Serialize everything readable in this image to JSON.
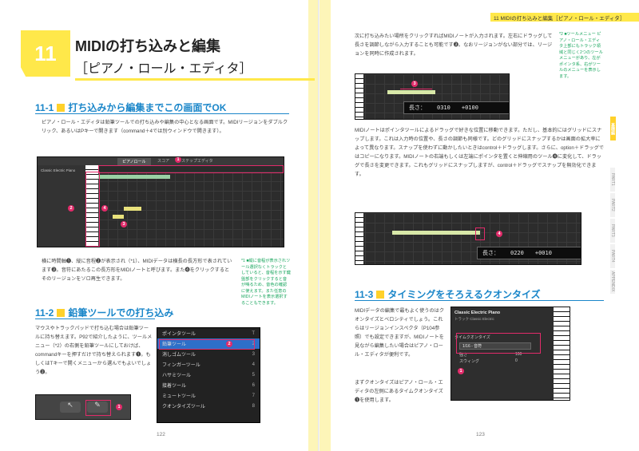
{
  "running_head": "11 MIDIの打ち込みと編集［ピアノ・ロール・エディタ］",
  "chapter": {
    "number": "11",
    "title_line1": "MIDIの打ち込みと編集",
    "title_line2": "［ピアノ・ロール・エディタ］"
  },
  "sections": {
    "s1": {
      "num": "11-1",
      "title": "打ち込みから編集までこの画面でOK"
    },
    "s2": {
      "num": "11-2",
      "title": "鉛筆ツールでの打ち込み"
    },
    "s3": {
      "num": "11-3",
      "title": "タイミングをそろえるクオンタイズ"
    }
  },
  "text": {
    "p1": "ピアノ・ロール・エディタは鉛筆ツールでの打ち込みや編集の中心となる画面です。MIDIリージョンをダブルクリック、あるいはPキーで開きます（command＋4では別ウィンドウで開きます）。",
    "p2": "横に時間軸❶、縦に音程❷が表示され（*1）、MIDIデータは横長の長方形で表されています❸。音符にあたるこの長方形をMIDIノートと呼びます。また❹をクリックするとそのリージョンをソロ再生できます。",
    "p3": "マウスやトラックパッドで打ち込む場合は鉛筆ツールに持ち替えます。P92で紹介したように、ツールメニュー（*2）の右側を鉛筆ツールにしておけば、commandキーを押すだけで持ち替えられます❶。もしくはTキーで開くメニューから選んでもよいでしょう❷。",
    "p4": "次に打ち込みたい場所をクリックすればMIDIノートが入力されます。左右にドラッグして長さを調節しながら入力することも可能です❸。なおリージョンがない部分では、リージョンを同時に作成されます。",
    "p5": "MIDIノートはポインタツールによるドラッグで好きな位置に移動できます。ただし、基本的にはグリッドにスナップします。これは入力時の位置や、長さの調節も同様です。どのグリッドにスナップするかは画面の拡大率によって異なります。スナップを使わずに動かしたいときはcontrol＋ドラッグします。さらに、option＋ドラッグではコピーになります。MIDIノートの右端もしくは左端にポインタを置くと伸縮用のツール❹に変化して、ドラッグで長さを変更できます。これもグリッドにスナップしますが、control＋ドラッグでスナップを無効化できます。",
    "p6": "MIDIデータの編集で最もよく使うのはクオンタイズとベロシティでしょう。これらはリージョンインスペクタ（P104参照）でも設定できますが、MIDIノートを見ながら編集したい場合はピアノ・ロール・エディタが便利です。",
    "p7": "まずクオンタイズはピアノ・ロール・エディタの左側にあるタイムクオンタイズ❶を使用します。"
  },
  "notes": {
    "n1": "*1 ■縦に音程が表示されツール選択なくトラックとしていると、音程を示す鍵盤部をクリックすると音が鳴るため、音色の確認に使えます。また任意のMIDIノートを表示選択することもできます。",
    "n2": "*2 ■ツールメニュー ピアノ・ロール・エディタ上部にもトラック領域と同じく2つのツールメニューがあり、左がポインタ系、右がツールのメニューを表示します。"
  },
  "screens": {
    "editor_tabs": [
      "ピアノロール",
      "スコア",
      "ステップエディタ"
    ],
    "region_name": "Classic Electric Piano",
    "readout1": {
      "label": "長さ：",
      "a": "0310",
      "b": "+0100"
    },
    "readout2": {
      "label": "長さ：",
      "a": "0220",
      "b": "+0010"
    },
    "inspector": {
      "name": "Classic Electric Piano",
      "sub": "トラック Classic Electric",
      "q_label": "タイムクオンタイズ",
      "q_value": "1/16 - 音符",
      "strength_label": "強さ",
      "strength_value": "100",
      "swing_label": "スウィング",
      "swing_value": "0"
    }
  },
  "toolmenu": [
    {
      "label": "ポインタツール",
      "key": "T"
    },
    {
      "label": "鉛筆ツール",
      "key": "2"
    },
    {
      "label": "消しゴムツール",
      "key": "3"
    },
    {
      "label": "フィンガーツール",
      "key": "4"
    },
    {
      "label": "ハサミツール",
      "key": "5"
    },
    {
      "label": "接着ツール",
      "key": "6"
    },
    {
      "label": "ミュートツール",
      "key": "7"
    },
    {
      "label": "クオンタイズツール",
      "key": "8"
    }
  ],
  "tabs": [
    "基礎編",
    "",
    "PART1",
    "PART2",
    "PART3",
    "PART4",
    "APPENDIX"
  ],
  "page_numbers": {
    "left": "122",
    "right": "123"
  },
  "colors": {
    "accent_yellow": "#ffe84a",
    "heading_blue": "#1a86c9",
    "keyword_pink": "#e84a8a",
    "badge": "#e22b6a"
  }
}
